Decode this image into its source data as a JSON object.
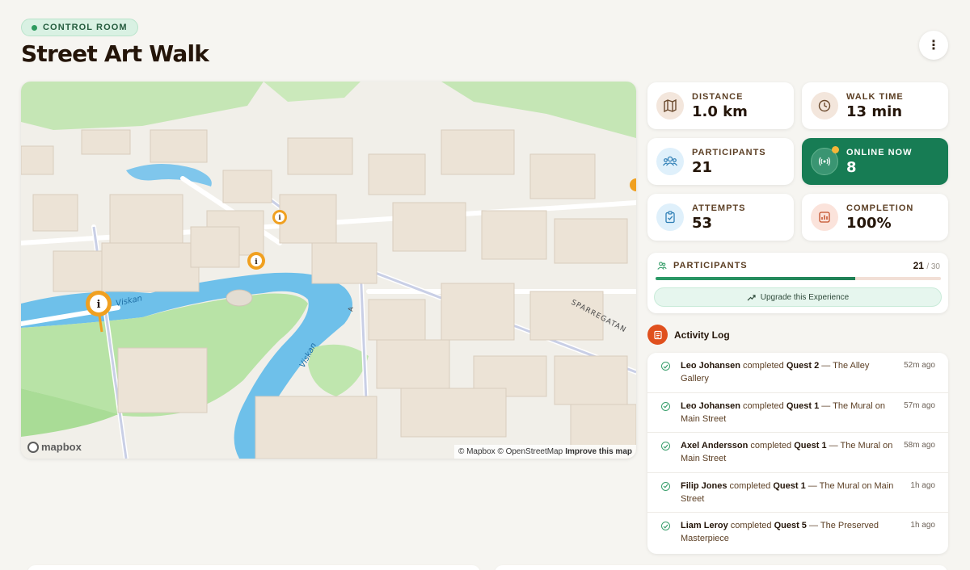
{
  "header": {
    "badge": "CONTROL ROOM",
    "title": "Street Art Walk",
    "more_icon": "more-vertical-icon",
    "more_label": "⋮"
  },
  "map": {
    "logo": "mapbox",
    "attribution": "© Mapbox © OpenStreetMap",
    "improve": "Improve this map",
    "labels": {
      "river1": "Viskan",
      "river2": "Viskan",
      "street": "SPARREGATAN",
      "road": "A"
    },
    "colors": {
      "water": "#6ec0ea",
      "park": "#b8e3a6",
      "building": "#ece4d8",
      "pin": "#f0a020"
    }
  },
  "stats": [
    {
      "label": "DISTANCE",
      "value": "1.0 km",
      "icon": "map-icon"
    },
    {
      "label": "WALK TIME",
      "value": "13 min",
      "icon": "clock-icon"
    },
    {
      "label": "PARTICIPANTS",
      "value": "21",
      "icon": "users-icon"
    },
    {
      "label": "ONLINE NOW",
      "value": "8",
      "icon": "broadcast-icon"
    },
    {
      "label": "ATTEMPTS",
      "value": "53",
      "icon": "clipboard-check-icon"
    },
    {
      "label": "COMPLETION",
      "value": "100%",
      "icon": "bar-chart-icon"
    }
  ],
  "participants": {
    "label": "PARTICIPANTS",
    "count": "21",
    "limit": "/ 30",
    "progress": 0.7,
    "upgrade": "Upgrade this Experience"
  },
  "activity": {
    "title": "Activity Log",
    "entries": [
      {
        "name": "Leo Johansen",
        "verb": "completed",
        "quest": "Quest 2",
        "detail": "— The Alley Gallery",
        "time": "52m ago"
      },
      {
        "name": "Leo Johansen",
        "verb": "completed",
        "quest": "Quest 1",
        "detail": "— The Mural on Main Street",
        "time": "57m ago"
      },
      {
        "name": "Axel Andersson",
        "verb": "completed",
        "quest": "Quest 1",
        "detail": "— The Mural on Main Street",
        "time": "58m ago"
      },
      {
        "name": "Filip Jones",
        "verb": "completed",
        "quest": "Quest 1",
        "detail": "— The Mural on Main Street",
        "time": "1h ago"
      },
      {
        "name": "Liam Leroy",
        "verb": "completed",
        "quest": "Quest 5",
        "detail": "— The Preserved Masterpiece",
        "time": "1h ago"
      }
    ]
  },
  "colors": {
    "accent_green": "#177c54",
    "activity_red": "#e0501e",
    "pin_orange": "#f0a020"
  }
}
